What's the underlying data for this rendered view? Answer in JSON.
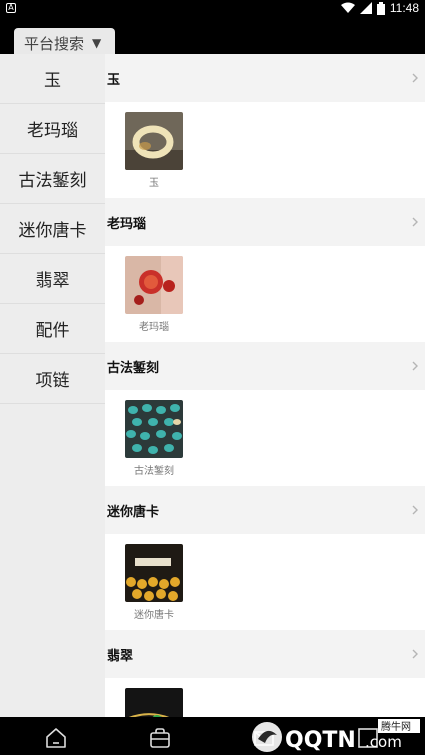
{
  "status_bar": {
    "time": "11:48"
  },
  "top_bar": {
    "search_label": "平台搜索",
    "dropdown_glyph": "▼"
  },
  "sidebar": {
    "items": [
      {
        "label": "玉"
      },
      {
        "label": "老玛瑙"
      },
      {
        "label": "古法錾刻"
      },
      {
        "label": "迷你唐卡"
      },
      {
        "label": "翡翠"
      },
      {
        "label": "配件"
      },
      {
        "label": "项链"
      }
    ]
  },
  "sections": [
    {
      "title": "玉",
      "product_label": "玉"
    },
    {
      "title": "老玛瑙",
      "product_label": "老玛瑙"
    },
    {
      "title": "古法錾刻",
      "product_label": "古法錾刻"
    },
    {
      "title": "迷你唐卡",
      "product_label": "迷你唐卡"
    },
    {
      "title": "翡翠",
      "product_label": ""
    }
  ],
  "watermark": {
    "brand": "QQTN",
    "suffix": ".com",
    "cn": "腾牛网"
  },
  "icons": {
    "bottom_nav": [
      "home-icon",
      "shop-bag-icon",
      "mail-icon",
      "grid-icon"
    ],
    "status": [
      "wifi-icon",
      "signal-icon",
      "battery-icon",
      "notification-icon"
    ],
    "section_arrow": "chevron-right-icon"
  }
}
